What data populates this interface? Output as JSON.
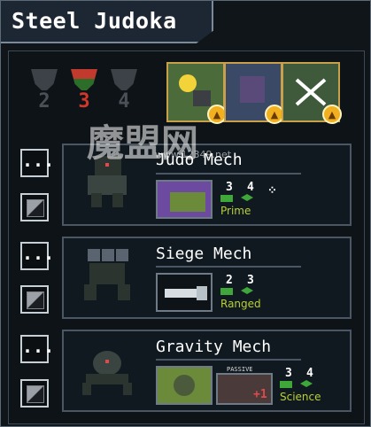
{
  "squad": {
    "title": "Steel Judoka"
  },
  "pilots": [
    {
      "level": "2",
      "state": "locked"
    },
    {
      "level": "3",
      "state": "active"
    },
    {
      "level": "4",
      "state": "locked"
    }
  ],
  "controls": {
    "menu_label": "..."
  },
  "mechs": [
    {
      "name": "Judo Mech",
      "hp": "3",
      "move": "4",
      "class": "Prime",
      "weapon": "vice-fist-icon",
      "extra": "dots-icon"
    },
    {
      "name": "Siege Mech",
      "hp": "2",
      "move": "3",
      "class": "Ranged",
      "weapon": "artillery-cannon-icon"
    },
    {
      "name": "Gravity Mech",
      "hp": "3",
      "move": "4",
      "class": "Science",
      "weapon": "grav-well-icon",
      "passive_label": "PASSIVE",
      "passive_value": "+1"
    }
  ],
  "watermark": {
    "brand": "魔盟网",
    "url": "www.12349.net"
  },
  "colors": {
    "accent_class": "#b8d035",
    "hp_green": "#3fa63a",
    "active_pilot": "#d2372b",
    "reward_badge": "#f0b020"
  }
}
